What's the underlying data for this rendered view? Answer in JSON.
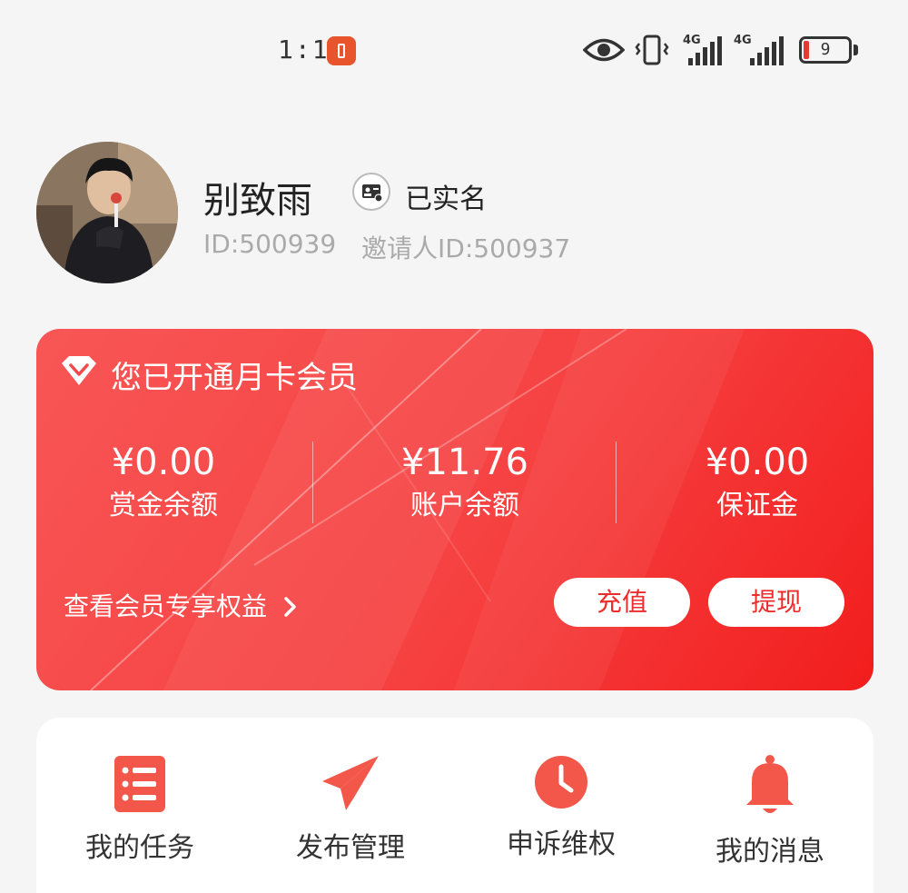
{
  "status_bar": {
    "time": "1:11",
    "battery_level": "9",
    "network_1": "4G",
    "network_2": "4G"
  },
  "profile": {
    "name": "别致雨",
    "verified_label": "已实名",
    "user_id": "ID:500939",
    "inviter_id": "邀请人ID:500937"
  },
  "member_card": {
    "title": "您已开通月卡会员",
    "stats": [
      {
        "amount": "¥0.00",
        "label": "赏金余额"
      },
      {
        "amount": "¥11.76",
        "label": "账户余额"
      },
      {
        "amount": "¥0.00",
        "label": "保证金"
      }
    ],
    "benefits_link": "查看会员专享权益",
    "recharge_button": "充值",
    "withdraw_button": "提现",
    "gradient_start": "#f85656",
    "gradient_end": "#f21d1d"
  },
  "menu": {
    "items": [
      {
        "label": "我的任务",
        "icon": "task-list-icon"
      },
      {
        "label": "发布管理",
        "icon": "paper-plane-icon"
      },
      {
        "label": "申诉维权",
        "icon": "clock-icon"
      },
      {
        "label": "我的消息",
        "icon": "bell-icon"
      }
    ],
    "icon_color": "#f2574a"
  }
}
